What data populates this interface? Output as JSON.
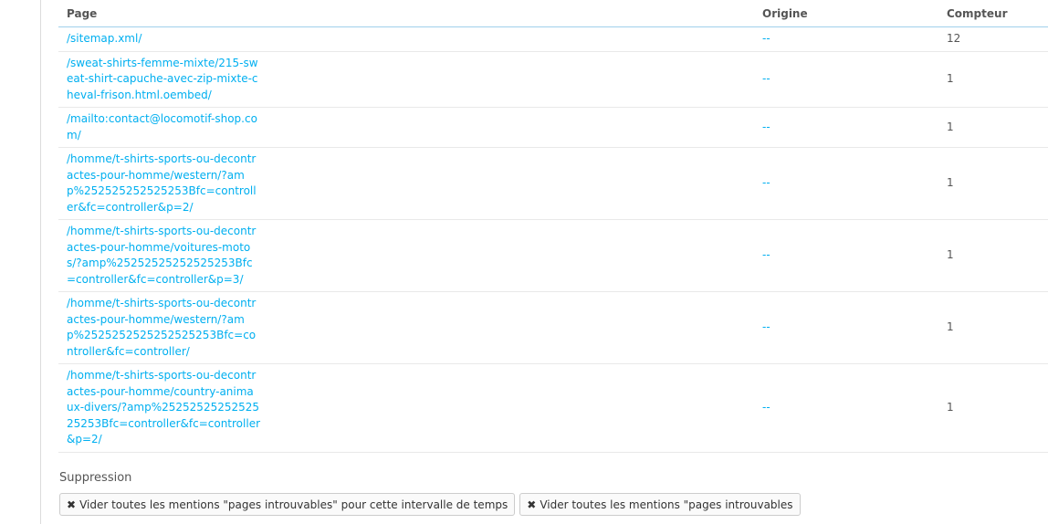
{
  "table": {
    "headers": {
      "page": "Page",
      "origin": "Origine",
      "counter": "Compteur"
    },
    "rows": [
      {
        "page": "/sitemap.xml/",
        "origin": "--",
        "counter": "12"
      },
      {
        "page": "/sweat-shirts-femme-mixte/215-sweat-shirt-capuche-avec-zip-mixte-cheval-frison.html.oembed/",
        "origin": "--",
        "counter": "1"
      },
      {
        "page": "/mailto:contact@locomotif-shop.com/",
        "origin": "--",
        "counter": "1"
      },
      {
        "page": "/homme/t-shirts-sports-ou-decontractes-pour-homme/western/?amp%252525252525253Bfc=controller&fc=controller&p=2/",
        "origin": "--",
        "counter": "1"
      },
      {
        "page": "/homme/t-shirts-sports-ou-decontractes-pour-homme/voitures-motos/?amp%25252525252525253Bfc=controller&fc=controller&p=3/",
        "origin": "--",
        "counter": "1"
      },
      {
        "page": "/homme/t-shirts-sports-ou-decontractes-pour-homme/western/?amp%2525252525252525253Bfc=controller&fc=controller/",
        "origin": "--",
        "counter": "1"
      },
      {
        "page": "/homme/t-shirts-sports-ou-decontractes-pour-homme/country-animaux-divers/?amp%2525252525252525253Bfc=controller&fc=controller&p=2/",
        "origin": "--",
        "counter": "1"
      }
    ]
  },
  "suppression": {
    "title": "Suppression",
    "btn_interval": "Vider toutes les mentions \"pages introuvables\" pour cette intervalle de temps",
    "btn_all": "Vider toutes les mentions \"pages introuvables"
  },
  "icons": {
    "clear": "close-icon"
  }
}
